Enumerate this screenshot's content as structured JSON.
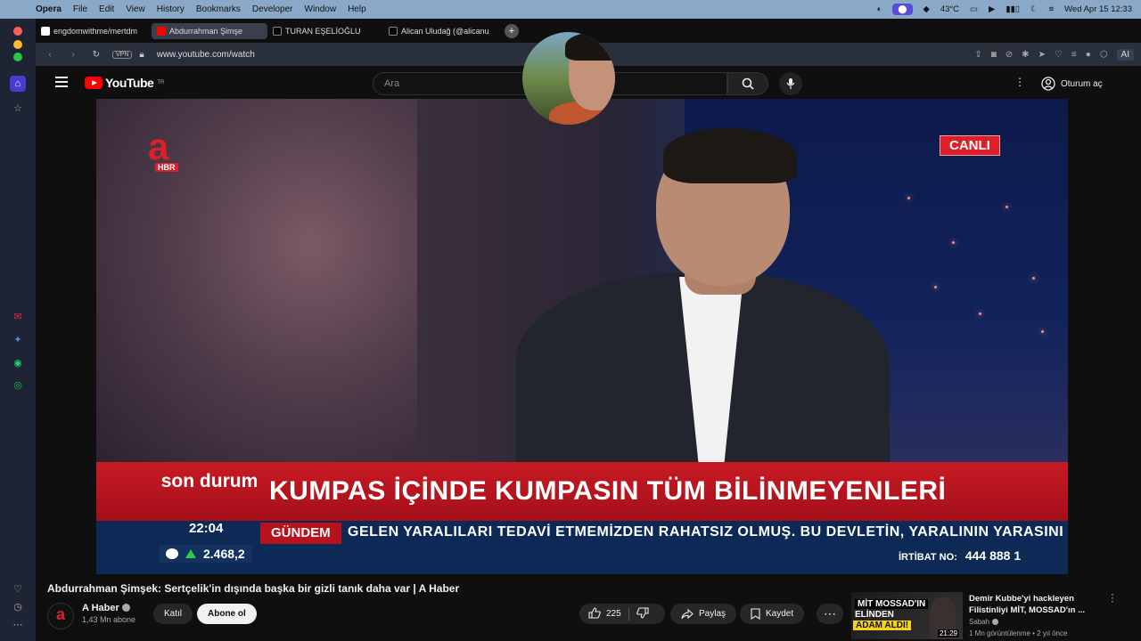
{
  "menubar": {
    "app": "Opera",
    "items": [
      "File",
      "Edit",
      "View",
      "History",
      "Bookmarks",
      "Developer",
      "Window",
      "Help"
    ],
    "temperature": "43°C",
    "datetime": "Wed Apr 15  12:33"
  },
  "tabs": [
    {
      "label": "engdomwithme/mertdm",
      "icon": "github-icon",
      "active": false
    },
    {
      "label": "Abdurrahman Şimşe",
      "icon": "youtube-icon",
      "active": true
    },
    {
      "label": "TURAN EŞELİOĞLU",
      "icon": "x-icon",
      "active": false
    },
    {
      "label": "Alican Uludağ (@alicanu",
      "icon": "x-icon",
      "active": false
    }
  ],
  "addressbar": {
    "vpn": "VPN",
    "url": "www.youtube.com/watch",
    "ai_label": "AI"
  },
  "youtube": {
    "logo_text": "YouTube",
    "logo_sup": "TR",
    "search_placeholder": "Ara",
    "signin": "Oturum aç"
  },
  "video": {
    "channel_logo_sub": "HBR",
    "live_badge": "CANLI",
    "lower_left": "son durum",
    "headline": "KUMPAS İÇİNDE KUMPASIN TÜM BİLİNMEYENLERİ",
    "clock": "22:04",
    "ticker_label": "GÜNDEM",
    "ticker_text": "GELEN YARALILARI TEDAVİ ETMEMİZDEN RAHATSIZ OLMUŞ. BU DEVLETİN, YARALININ YARASINI SAR",
    "market_value": "2.468,2",
    "irtibat_label": "İRTİBAT NO:",
    "irtibat_number": "444 888 1"
  },
  "watch": {
    "title": "Abdurrahman Şimşek: Sertçelik'in dışında başka bir gizli tanık daha var | A Haber",
    "channel": "A Haber",
    "subscribers": "1,43 Mn abone",
    "join_label": "Katıl",
    "subscribe_label": "Abone ol",
    "likes": "225",
    "share_label": "Paylaş",
    "save_label": "Kaydet"
  },
  "suggested": {
    "thumb_line1": "MİT MOSSAD'IN",
    "thumb_line2": "ELİNDEN",
    "thumb_line3": "ADAM ALDI!",
    "duration": "21:29",
    "title": "Demir Kubbe'yi hackleyen Filistinliyi MİT, MOSSAD'ın ...",
    "channel": "Sabah",
    "meta": "1 Mn görüntülenme • 2 yıl önce"
  }
}
